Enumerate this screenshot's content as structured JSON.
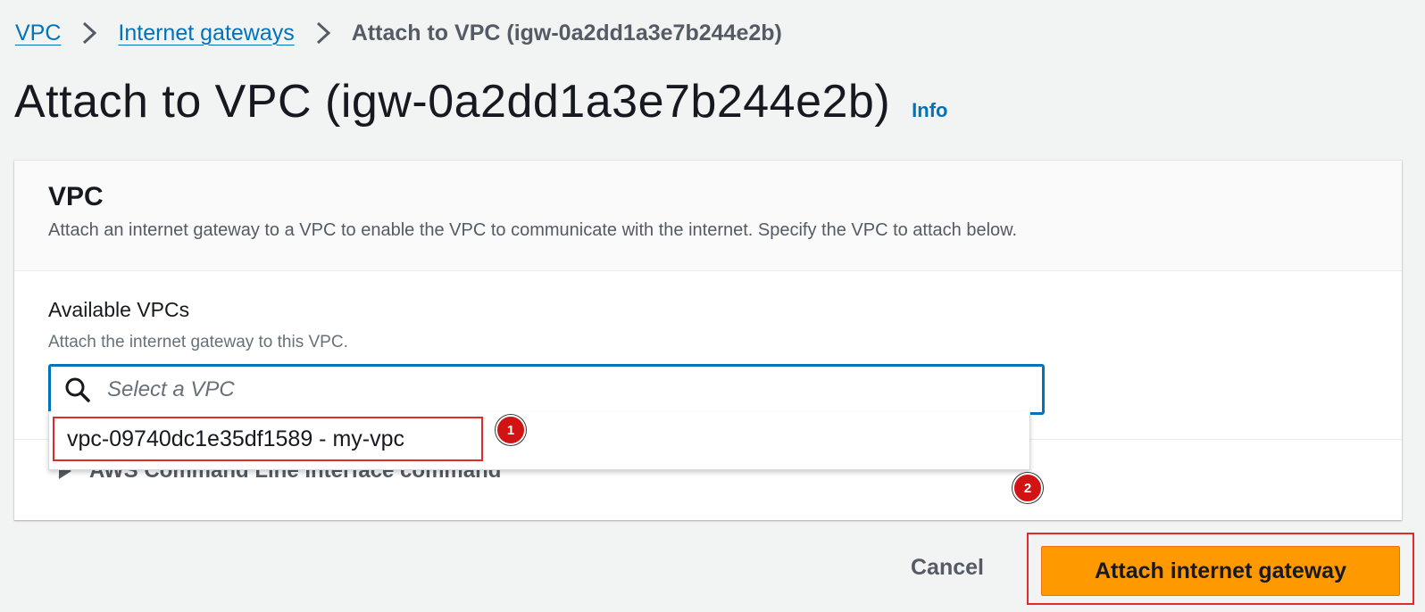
{
  "breadcrumb": {
    "items": [
      {
        "label": "VPC"
      },
      {
        "label": "Internet gateways"
      }
    ],
    "current": "Attach to VPC (igw-0a2dd1a3e7b244e2b)"
  },
  "page": {
    "title": "Attach to VPC (igw-0a2dd1a3e7b244e2b)",
    "info_link": "Info"
  },
  "panel": {
    "heading": "VPC",
    "description": "Attach an internet gateway to a VPC to enable the VPC to communicate with the internet. Specify the VPC to attach below."
  },
  "vpc_field": {
    "label": "Available VPCs",
    "hint": "Attach the internet gateway to this VPC.",
    "placeholder": "Select a VPC",
    "options": [
      {
        "label": "vpc-09740dc1e35df1589 - my-vpc"
      }
    ]
  },
  "cli": {
    "label": "AWS Command Line Interface command"
  },
  "annotations": {
    "step1": "1",
    "step2": "2",
    "highlight_color": "#e02b2b"
  },
  "actions": {
    "cancel": "Cancel",
    "submit": "Attach internet gateway"
  },
  "colors": {
    "link": "#0073bb",
    "primary_button": "#ff9900",
    "background": "#f2f3f3"
  }
}
